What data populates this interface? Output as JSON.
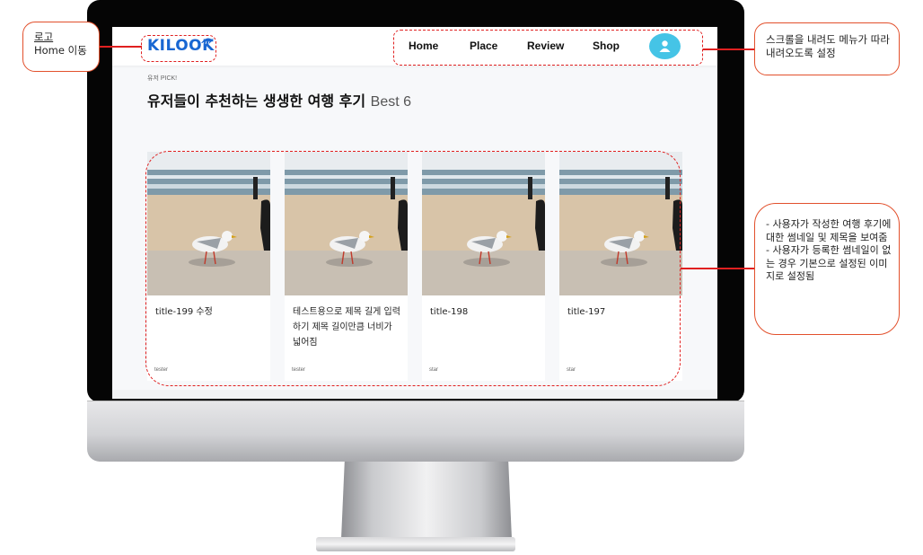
{
  "site": {
    "logo": "KILOOK",
    "nav": [
      "Home",
      "Place",
      "Review",
      "Shop"
    ],
    "avatar_icon": "user-icon",
    "accent": "#45c4e6",
    "logo_color": "#1967d2"
  },
  "section": {
    "eyebrow": "유저 PICK!",
    "title": "유저들이 추천하는 생생한 여행 후기",
    "best": "Best 6"
  },
  "cards": [
    {
      "title": "title-199 수정",
      "user": "tester"
    },
    {
      "title": "테스트용으로 제목 길게 입력하기 제목 길이만큼 너비가 넓어짐",
      "user": "tester"
    },
    {
      "title": "title-198",
      "user": "star"
    },
    {
      "title": "title-197",
      "user": "star"
    }
  ],
  "annotations": {
    "logo_title": "로고",
    "logo_desc": "Home 이동",
    "menu_note": "스크롤을 내려도 메뉴가 따라 내려오도록 설정",
    "cards_note": "- 사용자가 작성한 여행 후기에 대한 썸네일 및 제목을 보여줌\n- 사용자가 등록한 썸네일이 없는 경우 기본으로 설정된 이미지로 설정됨",
    "annotation_color": "#e02020"
  }
}
